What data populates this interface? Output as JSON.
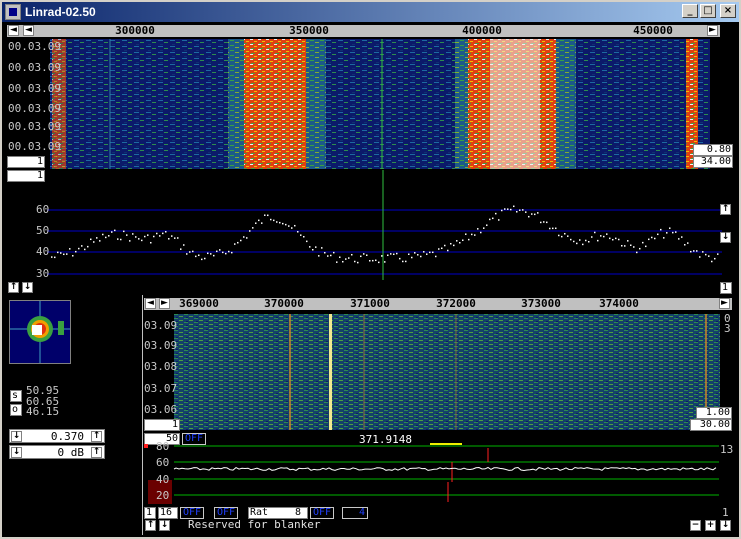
{
  "window": {
    "title": "Linrad-02.50"
  },
  "titlebar_buttons": [
    "_",
    "□",
    "×"
  ],
  "main_waterfall": {
    "freq_ticks": [
      "300000",
      "350000",
      "400000",
      "450000"
    ],
    "time_labels": [
      "00.03.09",
      "00.03.09",
      "00.03.09",
      "00.03.09",
      "00.03.09",
      "00.03.09"
    ],
    "gain_box": "0.80",
    "offset_box": "34.00",
    "left_box_top": "1",
    "left_box_bottom": "1"
  },
  "main_spectrum": {
    "db_labels": [
      "60",
      "50",
      "40",
      "30"
    ],
    "right_box": "1"
  },
  "baseband_waterfall": {
    "freq_ticks": [
      "369000",
      "370000",
      "371000",
      "372000",
      "373000",
      "374000"
    ],
    "time_labels": [
      "03.09",
      "03.09",
      "03.08",
      "03.07",
      "03.06"
    ],
    "right_top": [
      "0",
      "3"
    ],
    "gain_box": "1.00",
    "offset_box": "30.00",
    "left_box": "1"
  },
  "polarization": {
    "s_label": "s",
    "o_label": "o",
    "values": [
      "50.95",
      "60.65",
      "46.15"
    ]
  },
  "controls": {
    "gain_value": "0.370",
    "attenuation": "0 dB"
  },
  "baseband_spectrum": {
    "left_value": "50",
    "left_off": "OFF",
    "center_freq": "371.9148",
    "db_labels": [
      "80",
      "60",
      "40",
      "20"
    ],
    "right_value": "13",
    "bottom_bar": {
      "b1": "1",
      "b2": "16",
      "off1": "OFF",
      "off2": "OFF",
      "rat_label": "Rat",
      "rat_value": "8",
      "off3": "OFF",
      "val4": "4",
      "right_num": "1"
    },
    "status": "Reserved for blanker"
  },
  "colors": {
    "titlebar_start": "#0a246a",
    "titlebar_end": "#a6caf0",
    "grid_blue": "#0000c8",
    "grid_green": "#00b400",
    "off_blue": "#2040ff"
  }
}
